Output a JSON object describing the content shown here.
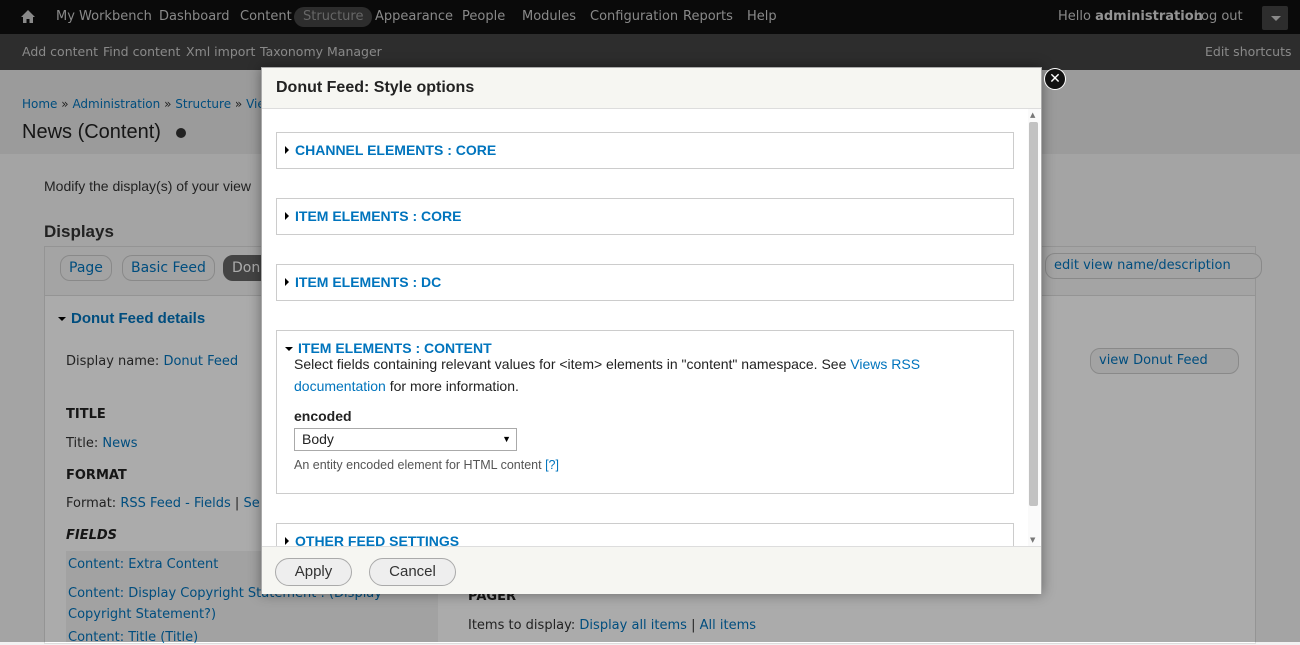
{
  "toolbar": {
    "items": [
      "My Workbench",
      "Dashboard",
      "Content",
      "Structure",
      "Appearance",
      "People",
      "Modules",
      "Configuration",
      "Reports",
      "Help"
    ],
    "hello_prefix": "Hello",
    "user": "administration",
    "logout": "Log out"
  },
  "shortcuts": {
    "items": [
      "Add content",
      "Find content",
      "Xml import",
      "Taxonomy Manager"
    ],
    "edit": "Edit shortcuts"
  },
  "page": {
    "breadcrumb": [
      "Home",
      "Administration",
      "Structure",
      "Views"
    ],
    "breadcrumb_sep": "»",
    "title": "News (Content)",
    "intro": "Modify the display(s) of your view",
    "displays_heading": "Displays",
    "display_tabs": [
      "Page",
      "Basic Feed",
      "Donu"
    ],
    "edit_view_button": "edit view name/description",
    "details_heading": "Donut Feed details",
    "display_name_label": "Display name:",
    "display_name_value": "Donut Feed",
    "view_button": "view Donut Feed",
    "title_heading": "TITLE",
    "title_label": "Title:",
    "title_value": "News",
    "format_heading": "FORMAT",
    "format_label": "Format:",
    "format_value": "RSS Feed - Fields",
    "format_sep": "|",
    "format_settings": "Se",
    "fields_heading": "FIELDS",
    "fields": [
      "Content: Extra Content",
      "Content: Display Copyright Statement : (Display Copyright Statement?)",
      "Content: Title (Title)"
    ],
    "pager_heading": "PAGER",
    "pager_label": "Items to display:",
    "pager_value": "Display all items",
    "pager_sep": "|",
    "pager_value2": "All items"
  },
  "modal": {
    "title": "Donut Feed: Style options",
    "sections": [
      {
        "label": "CHANNEL ELEMENTS : CORE",
        "expanded": false
      },
      {
        "label": "ITEM ELEMENTS : CORE",
        "expanded": false
      },
      {
        "label": "ITEM ELEMENTS : DC",
        "expanded": false
      },
      {
        "label": "ITEM ELEMENTS : CONTENT",
        "expanded": true
      },
      {
        "label": "OTHER FEED SETTINGS",
        "expanded": false
      }
    ],
    "content_desc": "Select fields containing relevant values for <item> elements in \"content\" namespace. See",
    "content_link": "Views RSS documentation",
    "content_desc_after": "for more information.",
    "field_label": "encoded",
    "field_value": "Body",
    "field_help": "An entity encoded element for HTML content",
    "field_help_link": "[?]",
    "apply": "Apply",
    "cancel": "Cancel"
  },
  "colors": {
    "link": "#0074bd",
    "toolbar": "#0f0f0f",
    "shortcuts": "#444444"
  }
}
